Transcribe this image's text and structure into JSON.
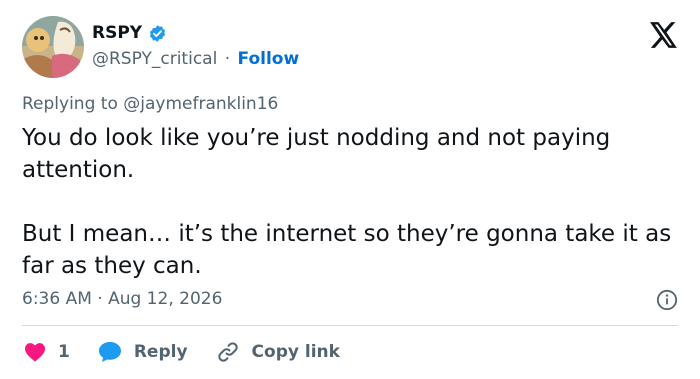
{
  "user": {
    "display_name": "RSPY",
    "handle": "@RSPY_critical",
    "separator": "·",
    "follow_label": "Follow",
    "avatar_icon": "avatar-illustration"
  },
  "tweet": {
    "reply_prefix": "Replying to",
    "reply_mention": "@jaymefranklin16",
    "paragraphs": [
      "You do look like you’re just nodding and not paying attention.",
      "But I mean… it’s the internet so they’re gonna take it as far as they can."
    ],
    "timestamp": "6:36 AM · Aug 12, 2026"
  },
  "actions": {
    "like_count": "1",
    "reply_label": "Reply",
    "copy_link_label": "Copy link"
  },
  "colors": {
    "link_blue": "#006fd6",
    "verified_blue": "#1d9bf0",
    "heart_red": "#f91880",
    "muted": "#536471",
    "text": "#0f1419",
    "divider": "#cfd9de"
  },
  "icons": {
    "verified": "verified-badge-icon",
    "brand": "x-logo-icon",
    "info": "info-icon",
    "like": "heart-icon",
    "reply": "chat-bubble-icon",
    "copy": "link-icon"
  }
}
